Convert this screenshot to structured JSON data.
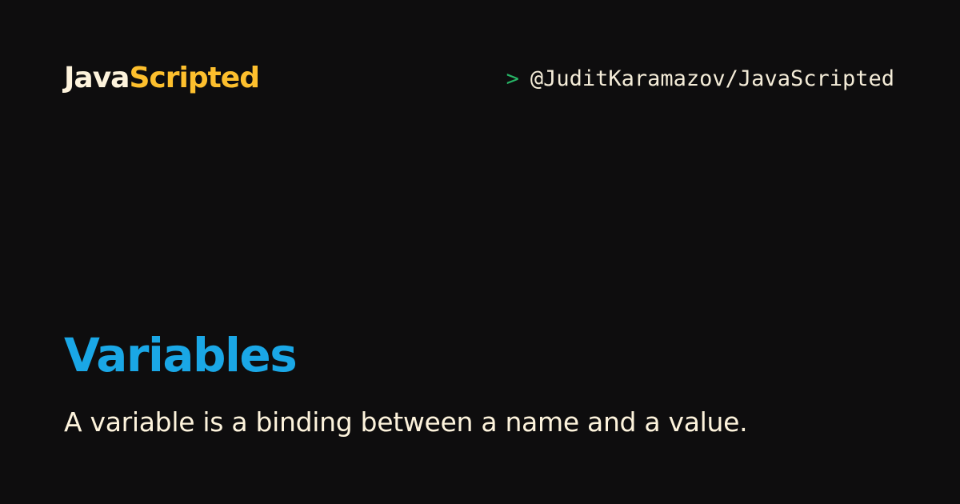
{
  "brand": {
    "part_a": "Java",
    "part_b": "Scripted"
  },
  "handle": {
    "prompt": ">",
    "text": "@JuditKaramazov/JavaScripted"
  },
  "article": {
    "title": "Variables",
    "description": "A variable is a binding between a name and a value."
  },
  "colors": {
    "background": "#0e0d0e",
    "brand_primary": "#fdf3dc",
    "brand_accent": "#fdbf2d",
    "prompt": "#27b566",
    "title": "#1aa7e6",
    "text": "#fdf3dc"
  }
}
